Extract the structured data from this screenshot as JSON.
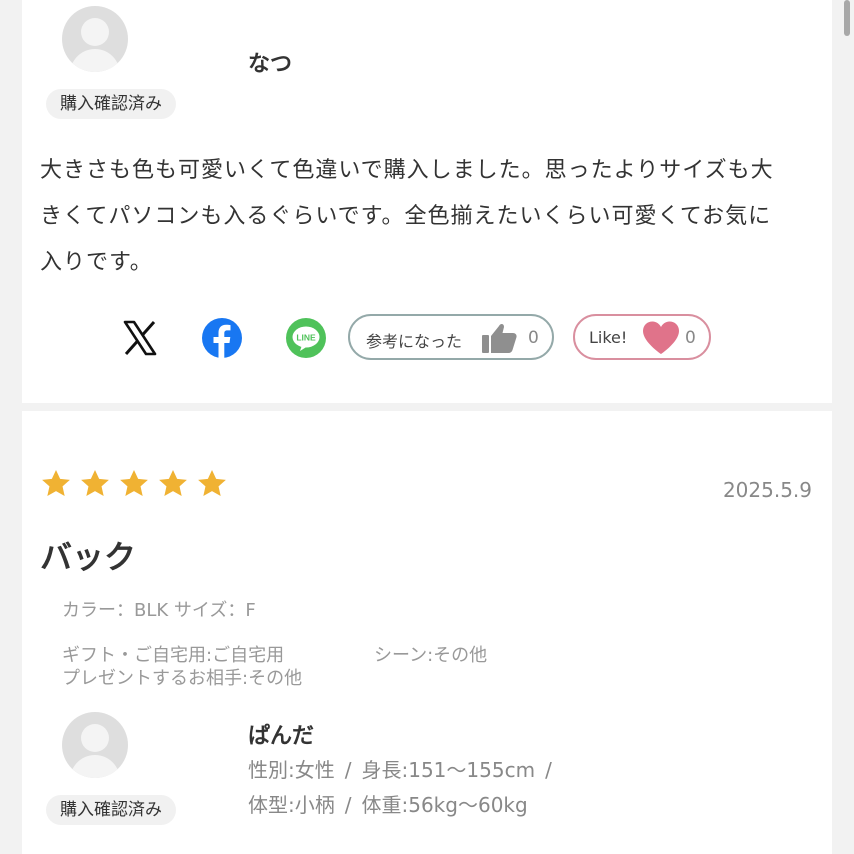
{
  "review1": {
    "username": "なつ",
    "badge": "購入確認済み",
    "text": "大きさも色も可愛いくて色違いで購入しました。思ったよりサイズも大きくてパソコンも入るぐらいです。全色揃えたいくらい可愛くてお気に入りです。",
    "helpful_label": "参考になった",
    "helpful_count": "0",
    "like_label": "Like!",
    "like_count": "0",
    "share_icons": [
      "x-icon",
      "facebook-icon",
      "line-icon"
    ],
    "colors": {
      "facebook": "#1877f2",
      "line": "#4fc25a",
      "heart": "#e0738a",
      "thumb": "#8f8f8f"
    }
  },
  "review2": {
    "rating": 5,
    "date": "2025.5.9",
    "title": "バック",
    "color_size": "カラー：BLK サイズ：F",
    "gift": "ギフト・ご自宅用:ご自宅用",
    "scene": "シーン:その他",
    "recipient": "プレゼントするお相手:その他",
    "username": "ぱんだ",
    "badge": "購入確認済み",
    "gender": "性別:女性",
    "height": "身長:151〜155cm",
    "body_type": "体型:小柄",
    "weight": "体重:56kg〜60kg",
    "separator": "/",
    "colors": {
      "star": "#f0b233"
    }
  }
}
